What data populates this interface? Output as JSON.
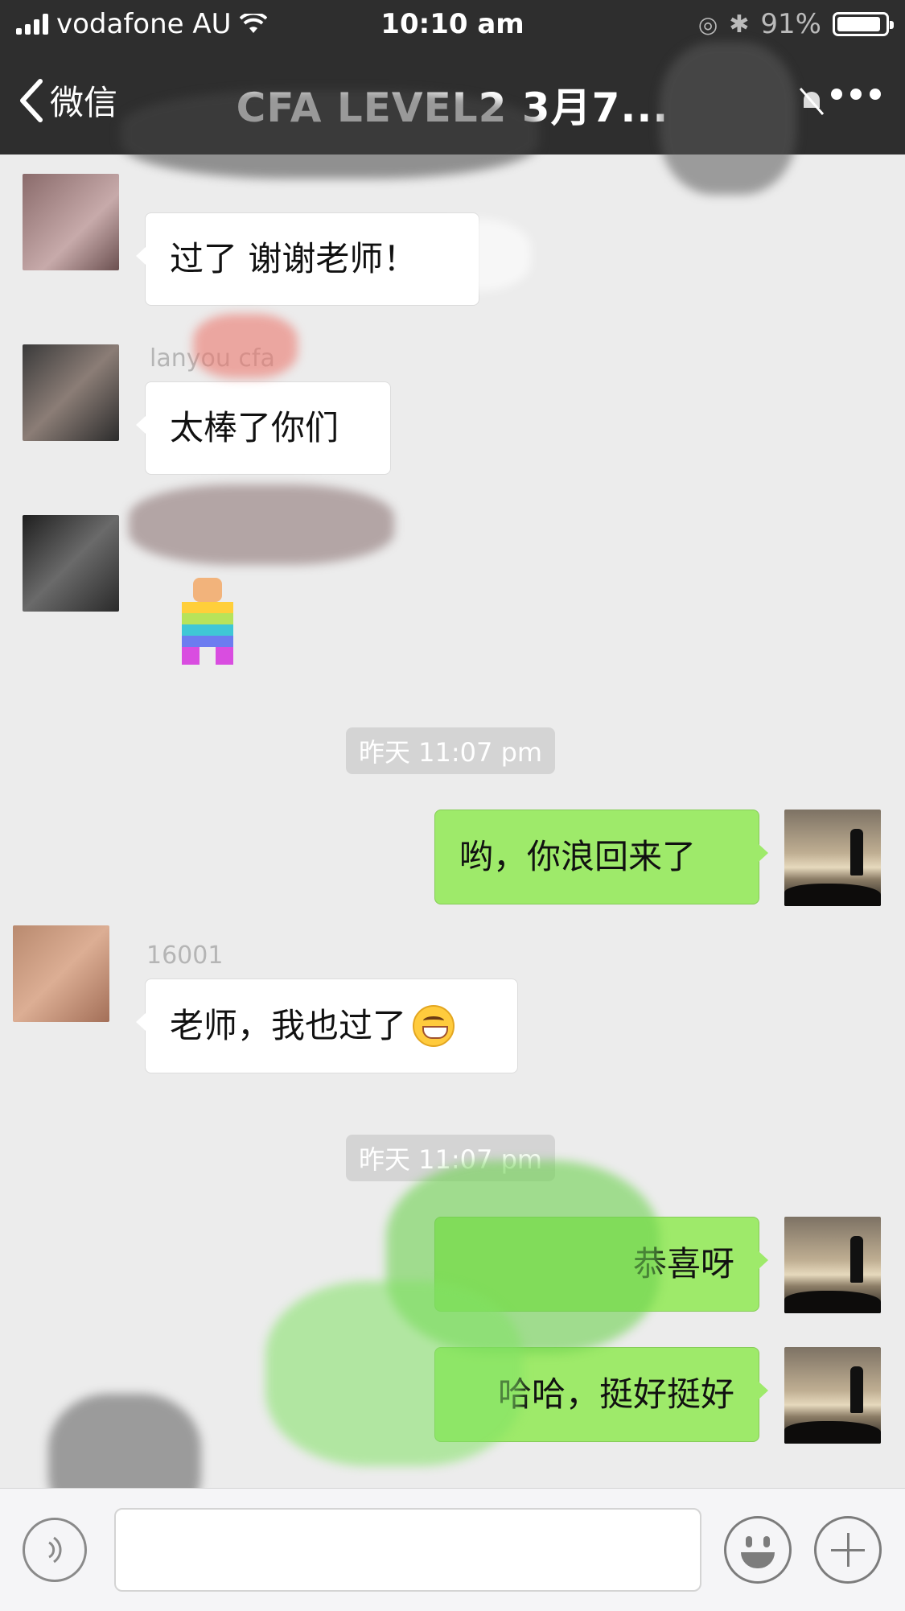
{
  "status_bar": {
    "carrier": "vodafone AU",
    "time": "10:10 am",
    "battery": "91%",
    "battery_level": 0.91
  },
  "nav": {
    "back_label": "微信",
    "title": "CFA LEVEL2 3月7..."
  },
  "chat": {
    "messages_left": [
      {
        "text": "过了 谢谢老师！"
      },
      {
        "sender": "lanyou cfa",
        "text": "太棒了你们"
      }
    ],
    "timestamp_1": "昨天 11:07 pm",
    "self_msg_1": "哟，你浪回来了",
    "left_msg_3": {
      "sender": "16001",
      "text": "老师，我也过了"
    },
    "timestamp_2": "昨天 11:07 pm",
    "self_msg_2": "恭喜呀",
    "self_msg_3": "哈哈，挺好挺好"
  },
  "colors": {
    "nav_bg": "#2e2e2e",
    "chat_bg": "#ececec",
    "self_bubble": "#9eea6a",
    "other_bubble": "#ffffff"
  }
}
